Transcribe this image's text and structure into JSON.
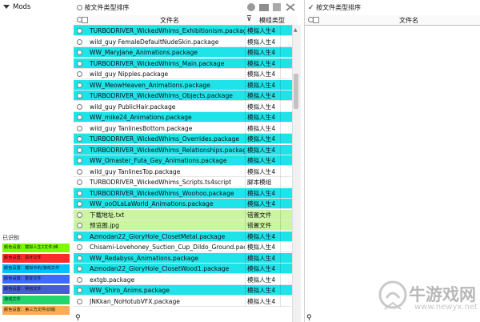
{
  "left_panel": {
    "tree_root": "Mods",
    "legend_title": "已识别",
    "legend": [
      {
        "label": "颜色设置：模拟人生2文件(维",
        "color": "#7cfc00"
      },
      {
        "label": "颜色设置：损坏文件",
        "color": "#ff2a2a"
      },
      {
        "label": "颜色设置：模拟中的/游戏文件",
        "color": "#00bfff"
      },
      {
        "label": "颜色设置：重复文件",
        "color": "#3b6cff"
      },
      {
        "label": "颜色设置：禁用文件",
        "color": "#4b5bd4"
      },
      {
        "label": "游戏文件",
        "color": "#22d66b"
      },
      {
        "label": "颜色设置：第三方文件(旧版",
        "color": "#ffaa55"
      }
    ]
  },
  "middle_panel": {
    "sort_label": "按文件类型排序",
    "header": {
      "filename": "文件名",
      "type": "模组类型"
    },
    "rows": [
      {
        "name": "TURBODRIVER_WickedWhims_Exhibitionism.package",
        "type": "模拟人生4",
        "color": "#1ee3e8"
      },
      {
        "name": "wild_guy FemaleDefaultNudeSkin.package",
        "type": "模拟人生4",
        "color": "#ffffff"
      },
      {
        "name": "WW_MaryJane_Animations.package",
        "type": "模拟人生4",
        "color": "#1ee3e8"
      },
      {
        "name": "TURBODRIVER_WickedWhims_Main.package",
        "type": "模拟人生4",
        "color": "#1ee3e8"
      },
      {
        "name": "wild_guy Nipples.package",
        "type": "模拟人生4",
        "color": "#ffffff"
      },
      {
        "name": "WW_MeowHeaven_Animations.package",
        "type": "模拟人生4",
        "color": "#1ee3e8"
      },
      {
        "name": "TURBODRIVER_WickedWhims_Objects.package",
        "type": "模拟人生4",
        "color": "#1ee3e8"
      },
      {
        "name": "wild_guy PublicHair.package",
        "type": "模拟人生4",
        "color": "#ffffff"
      },
      {
        "name": "WW_mike24_Animations.package",
        "type": "模拟人生4",
        "color": "#1ee3e8"
      },
      {
        "name": "wild_guy TanlinesBottom.package",
        "type": "模拟人生4",
        "color": "#ffffff"
      },
      {
        "name": "TURBODRIVER_WickedWhims_Overrides.package",
        "type": "模拟人生4",
        "color": "#1ee3e8"
      },
      {
        "name": "TURBODRIVER_WickedWhims_Relationships.package",
        "type": "模拟人生4",
        "color": "#1ee3e8"
      },
      {
        "name": "WW_Omaster_Futa_Gay_Animations.package",
        "type": "模拟人生4",
        "color": "#1ee3e8"
      },
      {
        "name": "wild_guy TanlinesTop.package",
        "type": "模拟人生4",
        "color": "#ffffff"
      },
      {
        "name": "TURBODRIVER_WickedWhims_Scripts.ts4script",
        "type": "脚本模组",
        "color": "#ffffff"
      },
      {
        "name": "TURBODRIVER_WickedWhims_Woohoo.package",
        "type": "模拟人生4",
        "color": "#1ee3e8"
      },
      {
        "name": "WW_ooOLaLaWorld_Animations.package",
        "type": "模拟人生4",
        "color": "#1ee3e8"
      },
      {
        "name": "下载地址.txt",
        "type": "错置文件",
        "color": "#ccf5a0"
      },
      {
        "name": "预览图.jpg",
        "type": "错置文件",
        "color": "#ccf5a0"
      },
      {
        "name": "Azmodan22_GloryHole_ClosetMetal.package",
        "type": "模拟人生4",
        "color": "#1ee3e8"
      },
      {
        "name": "Chisami-Lovehoney_Suction_Cup_Dildo_Ground.package",
        "type": "模拟人生4",
        "color": "#ffffff"
      },
      {
        "name": "WW_Redabyss_Animations.package",
        "type": "模拟人生4",
        "color": "#1ee3e8"
      },
      {
        "name": "Azmodan22_GloryHole_ClosetWood1.package",
        "type": "模拟人生4",
        "color": "#1ee3e8"
      },
      {
        "name": "extgb.package",
        "type": "模拟人生4",
        "color": "#ffffff"
      },
      {
        "name": "WW_Shiro_Anims.package",
        "type": "模拟人生4",
        "color": "#1ee3e8"
      },
      {
        "name": "JNKkan_NoHotubVFX.package",
        "type": "模拟人生4",
        "color": "#ffffff"
      }
    ]
  },
  "right_panel": {
    "sort_label": "按文件类型排序",
    "header": {
      "filename": "文件名"
    }
  },
  "watermark": {
    "title": "牛游戏网",
    "url": "www.newyx.net"
  }
}
